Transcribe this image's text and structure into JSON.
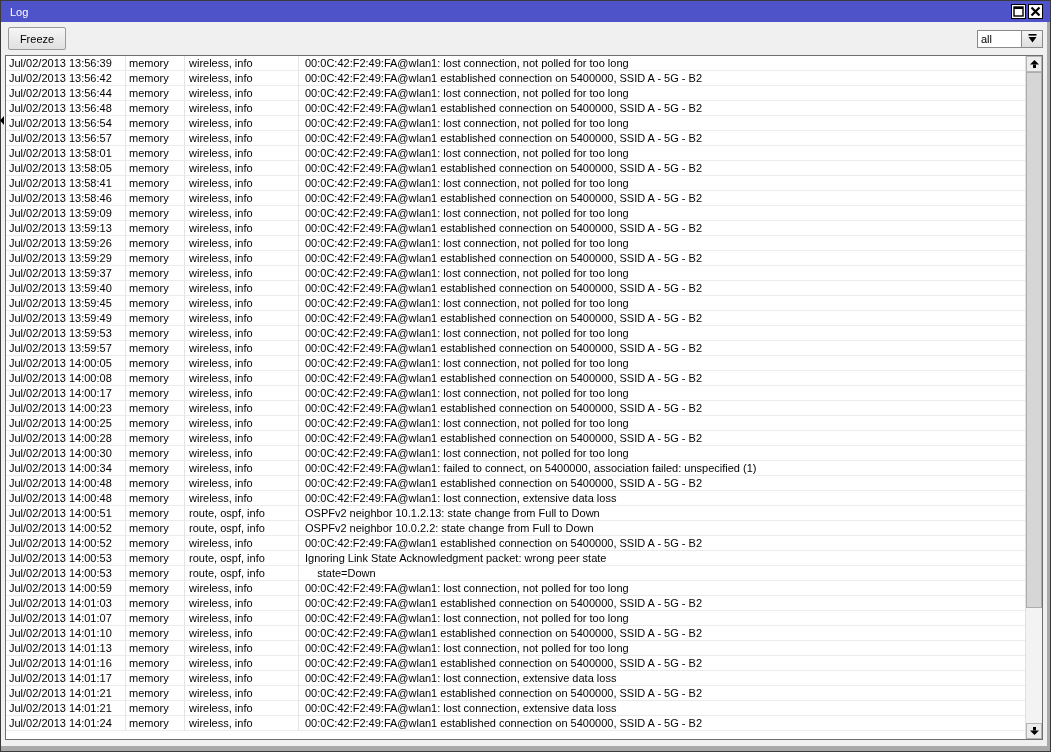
{
  "window": {
    "title": "Log"
  },
  "toolbar": {
    "freeze_button": "Freeze",
    "filter": {
      "value": "all"
    }
  },
  "log": {
    "rows": [
      [
        "Jul/02/2013 13:56:39",
        "memory",
        "wireless, info",
        "00:0C:42:F2:49:FA@wlan1: lost connection, not polled for too long"
      ],
      [
        "Jul/02/2013 13:56:42",
        "memory",
        "wireless, info",
        "00:0C:42:F2:49:FA@wlan1 established connection on 5400000, SSID A - 5G - B2"
      ],
      [
        "Jul/02/2013 13:56:44",
        "memory",
        "wireless, info",
        "00:0C:42:F2:49:FA@wlan1: lost connection, not polled for too long"
      ],
      [
        "Jul/02/2013 13:56:48",
        "memory",
        "wireless, info",
        "00:0C:42:F2:49:FA@wlan1 established connection on 5400000, SSID A - 5G - B2"
      ],
      [
        "Jul/02/2013 13:56:54",
        "memory",
        "wireless, info",
        "00:0C:42:F2:49:FA@wlan1: lost connection, not polled for too long"
      ],
      [
        "Jul/02/2013 13:56:57",
        "memory",
        "wireless, info",
        "00:0C:42:F2:49:FA@wlan1 established connection on 5400000, SSID A - 5G - B2"
      ],
      [
        "Jul/02/2013 13:58:01",
        "memory",
        "wireless, info",
        "00:0C:42:F2:49:FA@wlan1: lost connection, not polled for too long"
      ],
      [
        "Jul/02/2013 13:58:05",
        "memory",
        "wireless, info",
        "00:0C:42:F2:49:FA@wlan1 established connection on 5400000, SSID A - 5G - B2"
      ],
      [
        "Jul/02/2013 13:58:41",
        "memory",
        "wireless, info",
        "00:0C:42:F2:49:FA@wlan1: lost connection, not polled for too long"
      ],
      [
        "Jul/02/2013 13:58:46",
        "memory",
        "wireless, info",
        "00:0C:42:F2:49:FA@wlan1 established connection on 5400000, SSID A - 5G - B2"
      ],
      [
        "Jul/02/2013 13:59:09",
        "memory",
        "wireless, info",
        "00:0C:42:F2:49:FA@wlan1: lost connection, not polled for too long"
      ],
      [
        "Jul/02/2013 13:59:13",
        "memory",
        "wireless, info",
        "00:0C:42:F2:49:FA@wlan1 established connection on 5400000, SSID A - 5G - B2"
      ],
      [
        "Jul/02/2013 13:59:26",
        "memory",
        "wireless, info",
        "00:0C:42:F2:49:FA@wlan1: lost connection, not polled for too long"
      ],
      [
        "Jul/02/2013 13:59:29",
        "memory",
        "wireless, info",
        "00:0C:42:F2:49:FA@wlan1 established connection on 5400000, SSID A - 5G - B2"
      ],
      [
        "Jul/02/2013 13:59:37",
        "memory",
        "wireless, info",
        "00:0C:42:F2:49:FA@wlan1: lost connection, not polled for too long"
      ],
      [
        "Jul/02/2013 13:59:40",
        "memory",
        "wireless, info",
        "00:0C:42:F2:49:FA@wlan1 established connection on 5400000, SSID A - 5G - B2"
      ],
      [
        "Jul/02/2013 13:59:45",
        "memory",
        "wireless, info",
        "00:0C:42:F2:49:FA@wlan1: lost connection, not polled for too long"
      ],
      [
        "Jul/02/2013 13:59:49",
        "memory",
        "wireless, info",
        "00:0C:42:F2:49:FA@wlan1 established connection on 5400000, SSID A - 5G - B2"
      ],
      [
        "Jul/02/2013 13:59:53",
        "memory",
        "wireless, info",
        "00:0C:42:F2:49:FA@wlan1: lost connection, not polled for too long"
      ],
      [
        "Jul/02/2013 13:59:57",
        "memory",
        "wireless, info",
        "00:0C:42:F2:49:FA@wlan1 established connection on 5400000, SSID A - 5G - B2"
      ],
      [
        "Jul/02/2013 14:00:05",
        "memory",
        "wireless, info",
        "00:0C:42:F2:49:FA@wlan1: lost connection, not polled for too long"
      ],
      [
        "Jul/02/2013 14:00:08",
        "memory",
        "wireless, info",
        "00:0C:42:F2:49:FA@wlan1 established connection on 5400000, SSID A - 5G - B2"
      ],
      [
        "Jul/02/2013 14:00:17",
        "memory",
        "wireless, info",
        "00:0C:42:F2:49:FA@wlan1: lost connection, not polled for too long"
      ],
      [
        "Jul/02/2013 14:00:23",
        "memory",
        "wireless, info",
        "00:0C:42:F2:49:FA@wlan1 established connection on 5400000, SSID A - 5G - B2"
      ],
      [
        "Jul/02/2013 14:00:25",
        "memory",
        "wireless, info",
        "00:0C:42:F2:49:FA@wlan1: lost connection, not polled for too long"
      ],
      [
        "Jul/02/2013 14:00:28",
        "memory",
        "wireless, info",
        "00:0C:42:F2:49:FA@wlan1 established connection on 5400000, SSID A - 5G - B2"
      ],
      [
        "Jul/02/2013 14:00:30",
        "memory",
        "wireless, info",
        "00:0C:42:F2:49:FA@wlan1: lost connection, not polled for too long"
      ],
      [
        "Jul/02/2013 14:00:34",
        "memory",
        "wireless, info",
        "00:0C:42:F2:49:FA@wlan1: failed to connect, on 5400000, association failed: unspecified (1)"
      ],
      [
        "Jul/02/2013 14:00:48",
        "memory",
        "wireless, info",
        "00:0C:42:F2:49:FA@wlan1 established connection on 5400000, SSID A - 5G - B2"
      ],
      [
        "Jul/02/2013 14:00:48",
        "memory",
        "wireless, info",
        "00:0C:42:F2:49:FA@wlan1: lost connection, extensive data loss"
      ],
      [
        "Jul/02/2013 14:00:51",
        "memory",
        "route, ospf, info",
        "OSPFv2 neighbor 10.1.2.13: state change from Full to Down"
      ],
      [
        "Jul/02/2013 14:00:52",
        "memory",
        "route, ospf, info",
        "OSPFv2 neighbor 10.0.2.2: state change from Full to Down"
      ],
      [
        "Jul/02/2013 14:00:52",
        "memory",
        "wireless, info",
        "00:0C:42:F2:49:FA@wlan1 established connection on 5400000, SSID A - 5G - B2"
      ],
      [
        "Jul/02/2013 14:00:53",
        "memory",
        "route, ospf, info",
        "Ignoring Link State Acknowledgment packet: wrong peer state"
      ],
      [
        "Jul/02/2013 14:00:53",
        "memory",
        "route, ospf, info",
        "    state=Down"
      ],
      [
        "Jul/02/2013 14:00:59",
        "memory",
        "wireless, info",
        "00:0C:42:F2:49:FA@wlan1: lost connection, not polled for too long"
      ],
      [
        "Jul/02/2013 14:01:03",
        "memory",
        "wireless, info",
        "00:0C:42:F2:49:FA@wlan1 established connection on 5400000, SSID A - 5G - B2"
      ],
      [
        "Jul/02/2013 14:01:07",
        "memory",
        "wireless, info",
        "00:0C:42:F2:49:FA@wlan1: lost connection, not polled for too long"
      ],
      [
        "Jul/02/2013 14:01:10",
        "memory",
        "wireless, info",
        "00:0C:42:F2:49:FA@wlan1 established connection on 5400000, SSID A - 5G - B2"
      ],
      [
        "Jul/02/2013 14:01:13",
        "memory",
        "wireless, info",
        "00:0C:42:F2:49:FA@wlan1: lost connection, not polled for too long"
      ],
      [
        "Jul/02/2013 14:01:16",
        "memory",
        "wireless, info",
        "00:0C:42:F2:49:FA@wlan1 established connection on 5400000, SSID A - 5G - B2"
      ],
      [
        "Jul/02/2013 14:01:17",
        "memory",
        "wireless, info",
        "00:0C:42:F2:49:FA@wlan1: lost connection, extensive data loss"
      ],
      [
        "Jul/02/2013 14:01:21",
        "memory",
        "wireless, info",
        "00:0C:42:F2:49:FA@wlan1 established connection on 5400000, SSID A - 5G - B2"
      ],
      [
        "Jul/02/2013 14:01:21",
        "memory",
        "wireless, info",
        "00:0C:42:F2:49:FA@wlan1: lost connection, extensive data loss"
      ],
      [
        "Jul/02/2013 14:01:24",
        "memory",
        "wireless, info",
        "00:0C:42:F2:49:FA@wlan1 established connection on 5400000, SSID A - 5G - B2"
      ]
    ]
  }
}
